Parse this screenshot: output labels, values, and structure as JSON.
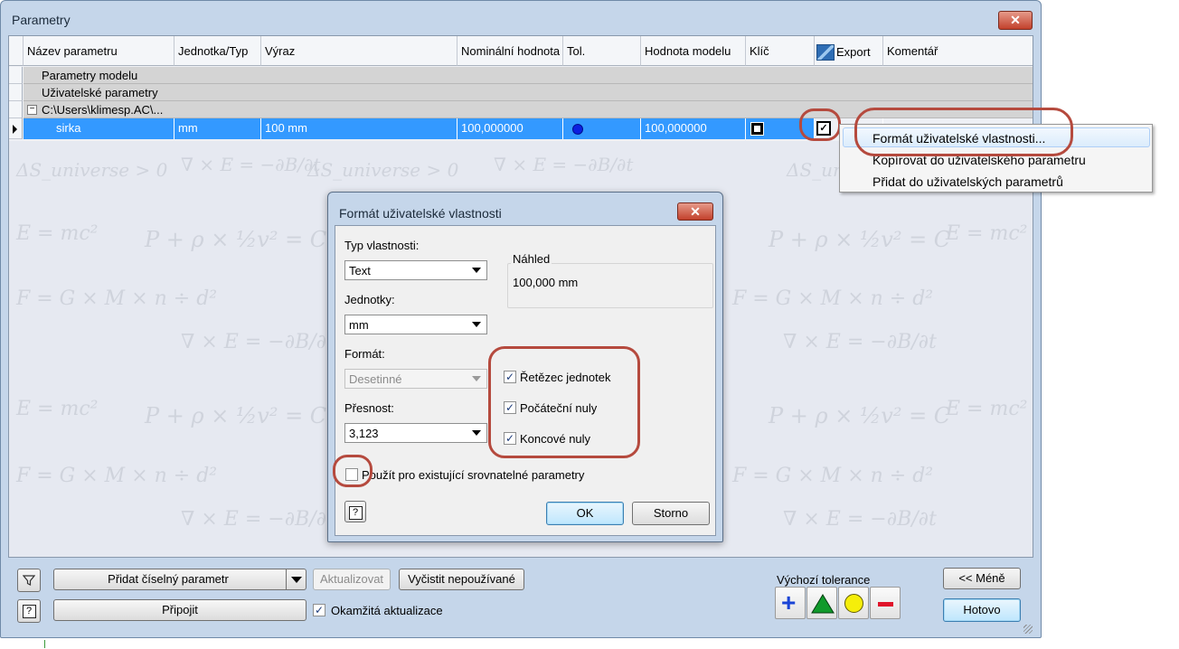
{
  "window": {
    "title": "Parametry",
    "close_label": "✕"
  },
  "grid": {
    "columns": [
      "Název parametru",
      "Jednotka/Typ",
      "Výraz",
      "Nominální hodnota",
      "Tol.",
      "Hodnota modelu",
      "Klíč",
      "Export",
      "Komentář"
    ],
    "groups": [
      "Parametry modelu",
      "Uživatelské parametry",
      "C:\\Users\\klimesp.AC\\..."
    ],
    "selected_row": {
      "name": "sirka",
      "unit": "mm",
      "expression": "100 mm",
      "nominal": "100,000000",
      "model_value": "100,000000"
    }
  },
  "context_menu": {
    "items": [
      "Formát uživatelské vlastnosti...",
      "Kopírovat do uživatelského parametru",
      "Přidat do uživatelských parametrů"
    ]
  },
  "dialog": {
    "title": "Formát uživatelské vlastnosti",
    "close_label": "✕",
    "type_label": "Typ vlastnosti:",
    "type_value": "Text",
    "units_label": "Jednotky:",
    "units_value": "mm",
    "format_label": "Formát:",
    "format_value": "Desetinné",
    "precision_label": "Přesnost:",
    "precision_value": "3,123",
    "preview_label": "Náhled",
    "preview_value": "100,000 mm",
    "checks": [
      {
        "label": "Řetězec jednotek",
        "checked": true
      },
      {
        "label": "Počáteční nuly",
        "checked": true
      },
      {
        "label": "Koncové nuly",
        "checked": true
      }
    ],
    "apply_existing_label": "Použít pro existující srovnatelné parametry",
    "help_label": "?",
    "ok_label": "OK",
    "cancel_label": "Storno"
  },
  "toolbar": {
    "filter_icon": "funnel-icon",
    "help_label": "?",
    "add_numeric_label": "Přidat číselný parametr",
    "update_label": "Aktualizovat",
    "purge_label": "Vyčistit nepoužívané",
    "link_label": "Připojit",
    "immediate_update_label": "Okamžitá aktualizace",
    "default_tolerance_label": "Výchozí tolerance",
    "less_label": "<< Méně",
    "done_label": "Hotovo"
  },
  "colors": {
    "selection": "#3399ff",
    "highlight_ring": "#b54a3e",
    "window_frame": "#c5d6ea"
  },
  "background_formulas": [
    "ΔS_universe > 0",
    "∇ × E = −∂B/∂t",
    "E = mc²",
    "P + ρ × ½v² = C",
    "F = G × M × n ÷ d²"
  ]
}
